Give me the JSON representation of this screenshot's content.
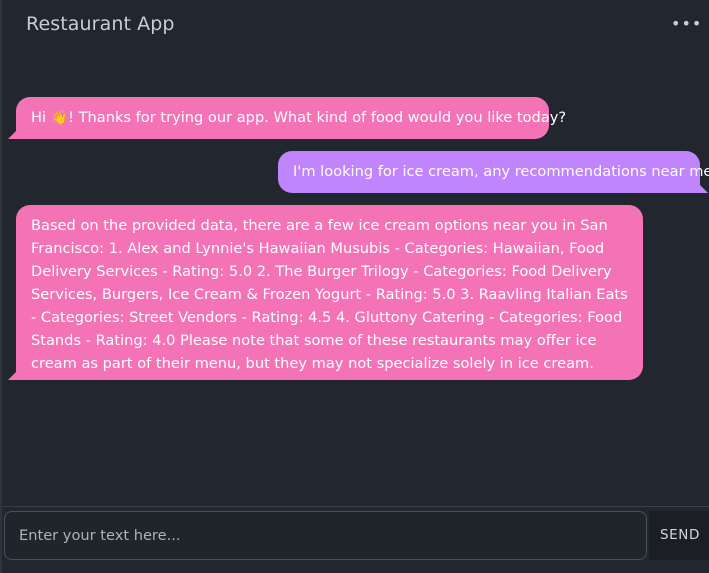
{
  "header": {
    "title": "Restaurant App",
    "menu_icon": "more-horizontal-icon",
    "menu_glyph": "•••"
  },
  "messages": [
    {
      "role": "bot",
      "text_before": "Hi ",
      "emoji": "👋",
      "text_after": "! Thanks for trying our app. What kind of food would you like today?"
    },
    {
      "role": "user",
      "text": "I'm looking for ice cream, any recommendations near me?"
    },
    {
      "role": "bot",
      "text": "Based on the provided data, there are a few ice cream options near you in San Francisco: 1. Alex and Lynnie's Hawaiian Musubis - Categories: Hawaiian, Food Delivery Services - Rating: 5.0 2. The Burger Trilogy - Categories: Food Delivery Services, Burgers, Ice Cream & Frozen Yogurt - Rating: 5.0 3. Raavling Italian Eats - Categories: Street Vendors - Rating: 4.5 4. Gluttony Catering - Categories: Food Stands - Rating: 4.0 Please note that some of these restaurants may offer ice cream as part of their menu, but they may not specialize solely in ice cream."
    }
  ],
  "input": {
    "value": "",
    "placeholder": "Enter your text here..."
  },
  "send_label": "SEND",
  "colors": {
    "background": "#22262e",
    "bot_bubble": "#f472b6",
    "user_bubble": "#c084fc",
    "text": "#ffffff"
  }
}
